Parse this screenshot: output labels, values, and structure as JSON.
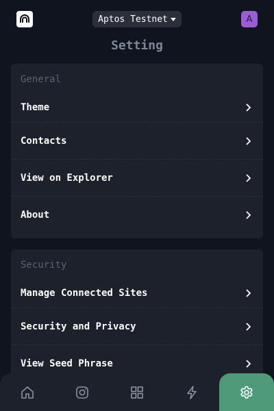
{
  "header": {
    "network_label": "Aptos Testnet",
    "avatar_letter": "A",
    "logo_icon": "aptos-logo-icon"
  },
  "page": {
    "title": "Setting"
  },
  "general": {
    "heading": "General",
    "items": [
      {
        "label": "Theme"
      },
      {
        "label": "Contacts"
      },
      {
        "label": "View on Explorer"
      },
      {
        "label": "About"
      }
    ]
  },
  "security": {
    "heading": "Security",
    "items": [
      {
        "label": "Manage Connected Sites"
      },
      {
        "label": "Security and Privacy"
      },
      {
        "label": "View Seed Phrase"
      }
    ]
  },
  "nav": {
    "items": [
      {
        "icon": "home-icon"
      },
      {
        "icon": "instagram-icon"
      },
      {
        "icon": "apps-grid-icon"
      },
      {
        "icon": "lightning-icon"
      },
      {
        "icon": "settings-gear-icon",
        "active": true
      }
    ]
  },
  "colors": {
    "background": "#0f141f",
    "card": "#1c212c",
    "accent": "#4f9a78",
    "avatar": "#9b5cd6"
  }
}
